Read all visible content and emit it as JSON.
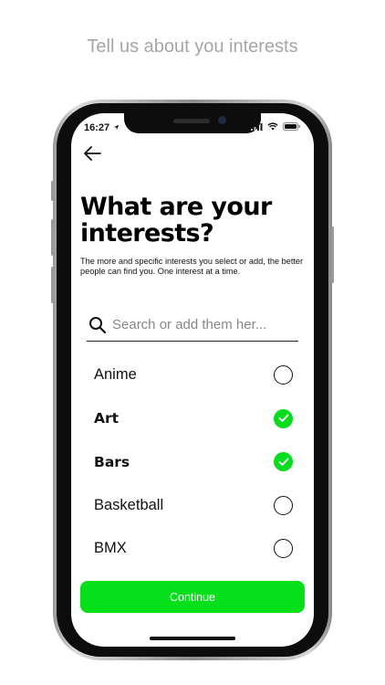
{
  "caption": "Tell us about you interests",
  "status_bar": {
    "time": "16:27"
  },
  "page": {
    "title": "What are your interests?",
    "description": "The more and specific interests you select or add, the better people can find you. One interest at a time."
  },
  "search": {
    "placeholder": "Search or add them her...",
    "value": ""
  },
  "interests": [
    {
      "label": "Anime",
      "selected": false
    },
    {
      "label": "Art",
      "selected": true
    },
    {
      "label": "Bars",
      "selected": true
    },
    {
      "label": "Basketball",
      "selected": false
    },
    {
      "label": "BMX",
      "selected": false
    }
  ],
  "continue_label": "Continue",
  "colors": {
    "accent": "#05e01b",
    "caption": "#a6a6a6"
  },
  "icons": [
    "back-arrow-icon",
    "search-icon",
    "checkmark-icon",
    "signal-icon",
    "wifi-icon",
    "battery-icon",
    "location-arrow-icon"
  ]
}
